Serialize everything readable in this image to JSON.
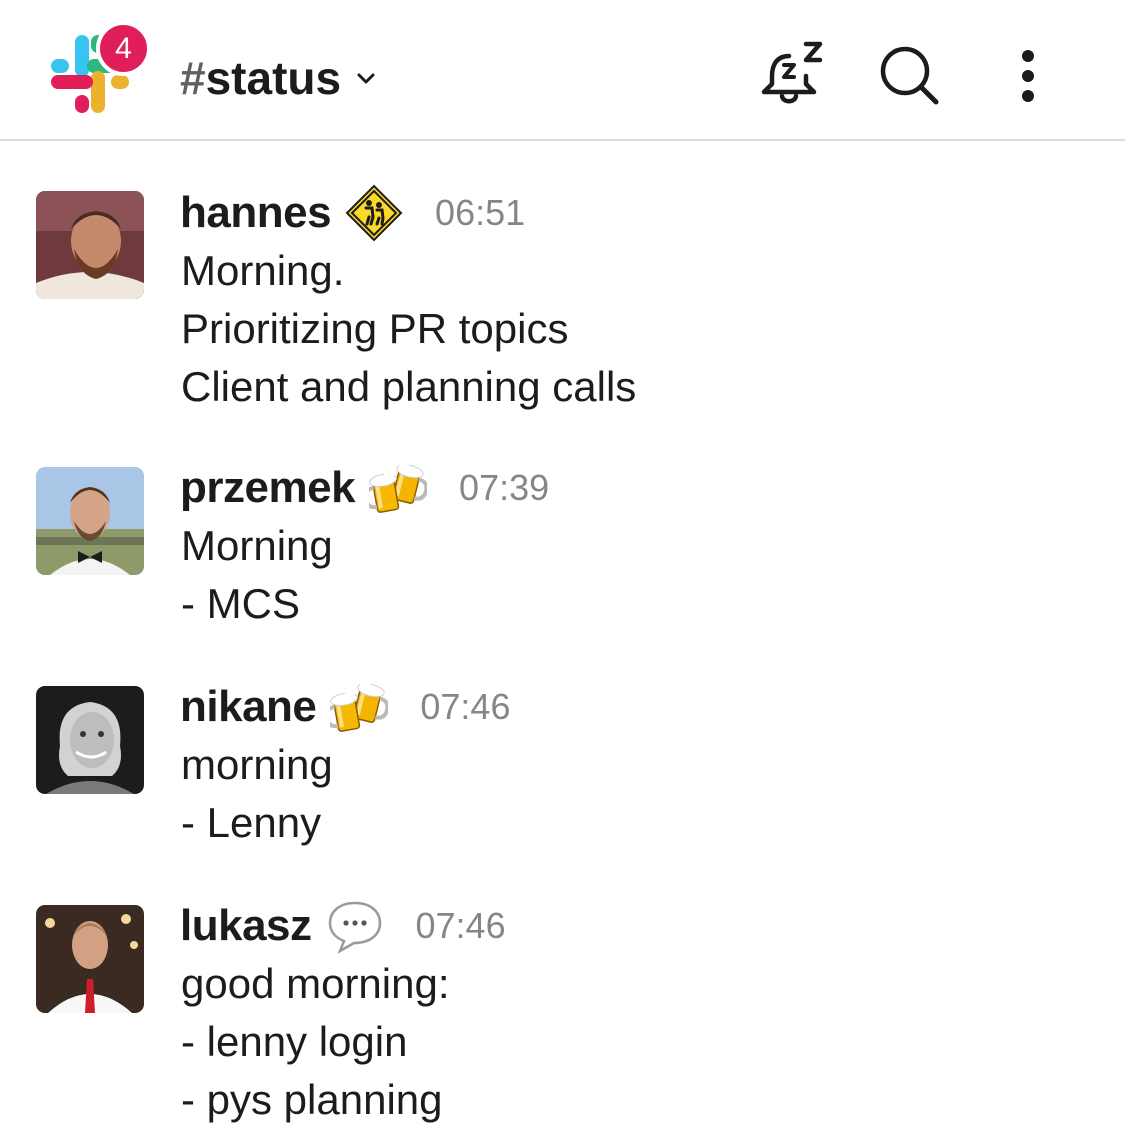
{
  "header": {
    "badge_count": "4",
    "channel_hash": "#",
    "channel_name": "status",
    "icons": [
      "slack-logo",
      "chevron-down-icon",
      "snooze-bell-icon",
      "search-icon",
      "more-vertical-icon"
    ]
  },
  "messages": [
    {
      "author": "hannes",
      "status_emoji": "children-crossing-sign",
      "time": "06:51",
      "lines": [
        "Morning.",
        "Prioritizing PR topics",
        "Client and planning calls"
      ]
    },
    {
      "author": "przemek",
      "status_emoji": "clinking-beer-mugs",
      "time": "07:39",
      "lines": [
        "Morning",
        "- MCS"
      ]
    },
    {
      "author": "nikane",
      "status_emoji": "clinking-beer-mugs",
      "time": "07:46",
      "lines": [
        "morning",
        "- Lenny"
      ]
    },
    {
      "author": "lukasz",
      "status_emoji": "speech-balloon",
      "time": "07:46",
      "lines": [
        "good morning:",
        "- lenny login",
        "- pys planning"
      ]
    }
  ],
  "colors": {
    "badge": "#e01e5a",
    "timestamp": "#868686",
    "text": "#1d1c1d",
    "divider": "#dddddd"
  }
}
